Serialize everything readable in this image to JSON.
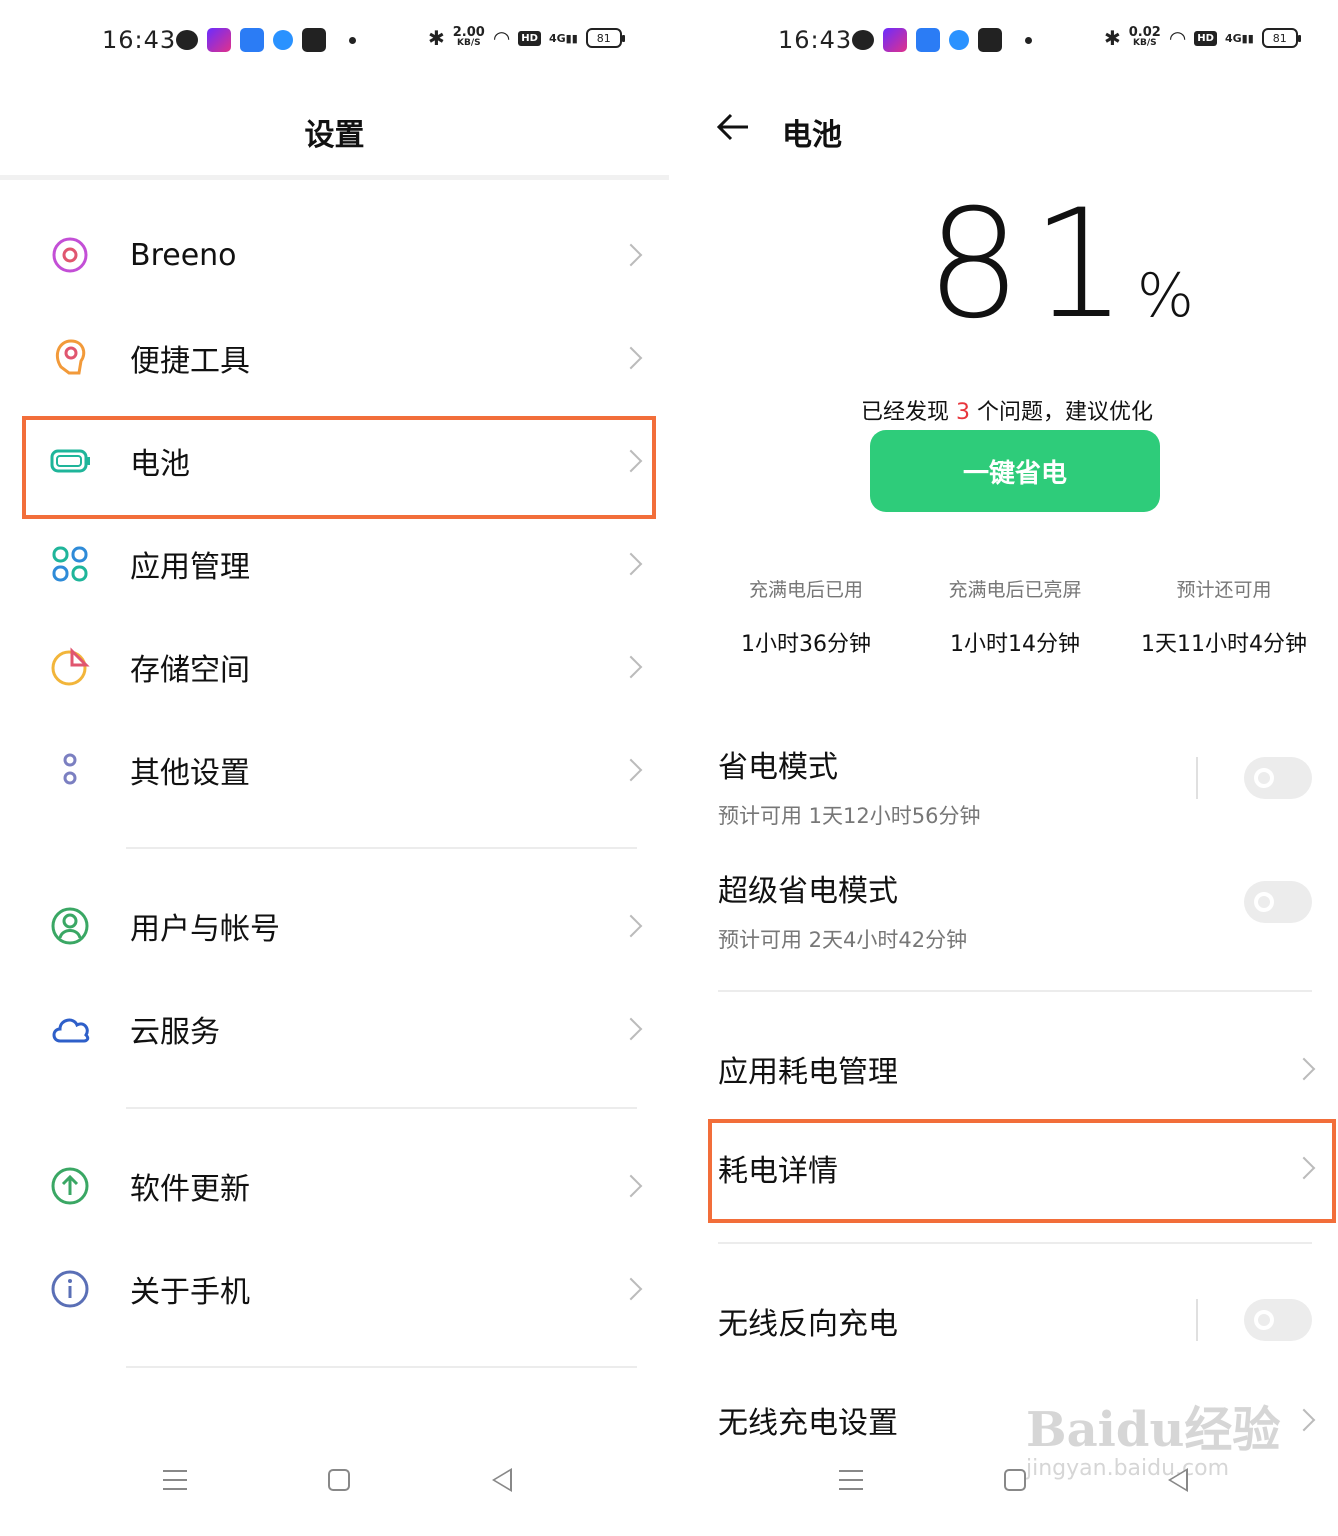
{
  "status_bar": {
    "time": "16:43",
    "left_speed": "2.00",
    "right_speed": "0.02",
    "speed_unit": "KB/S",
    "network": "4G",
    "hd": "HD",
    "battery": "81"
  },
  "settings": {
    "title": "设置",
    "items": [
      {
        "label": "Breeno",
        "icon": "breeno-icon"
      },
      {
        "label": "便捷工具",
        "icon": "tools-icon"
      },
      {
        "label": "电池",
        "icon": "battery-icon"
      },
      {
        "label": "应用管理",
        "icon": "apps-icon"
      },
      {
        "label": "存储空间",
        "icon": "storage-icon"
      },
      {
        "label": "其他设置",
        "icon": "other-icon"
      },
      {
        "label": "用户与帐号",
        "icon": "user-icon"
      },
      {
        "label": "云服务",
        "icon": "cloud-icon"
      },
      {
        "label": "软件更新",
        "icon": "update-icon"
      },
      {
        "label": "关于手机",
        "icon": "info-icon"
      }
    ]
  },
  "battery_page": {
    "title": "电池",
    "percent": "81",
    "percent_sign": "%",
    "issue_prefix": "已经发现",
    "issue_count": "3",
    "issue_suffix": "个问题，建议优化",
    "save_button": "一键省电",
    "stats": [
      {
        "label": "充满电后已用",
        "value": "1小时36分钟"
      },
      {
        "label": "充满电后已亮屏",
        "value": "1小时14分钟"
      },
      {
        "label": "预计还可用",
        "value": "1天11小时4分钟"
      }
    ],
    "modes": [
      {
        "title": "省电模式",
        "sub": "预计可用 1天12小时56分钟"
      },
      {
        "title": "超级省电模式",
        "sub": "预计可用 2天4小时42分钟"
      }
    ],
    "rows": [
      "应用耗电管理",
      "耗电详情",
      "无线反向充电",
      "无线充电设置"
    ]
  },
  "watermark": {
    "main": "Baidu经验",
    "sub": "jingyan.baidu.com"
  },
  "colors": {
    "highlight": "#f26e3a",
    "save_green": "#2ecc7a",
    "issue_red": "#e8363c"
  }
}
